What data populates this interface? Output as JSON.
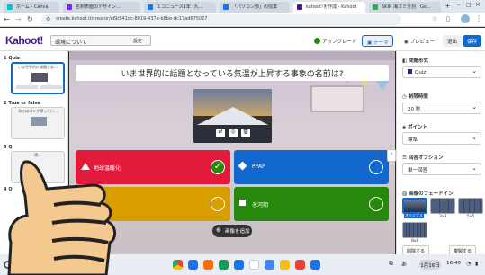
{
  "browser": {
    "tabs": [
      {
        "label": "ホーム - Canva",
        "color": "#00c4cc"
      },
      {
        "label": "名刺表面のデザイン…",
        "color": "#7d2ae8"
      },
      {
        "label": "エコニュース1年 (九…",
        "color": "#1a73e8"
      },
      {
        "label": "「パソコン部」の授業",
        "color": "#1a73e8"
      },
      {
        "label": "kahoot!を作成 - Kahoot",
        "color": "#46178f"
      },
      {
        "label": "SKIR 海ゴミ分別 - Go…",
        "color": "#34a853"
      }
    ],
    "url": "create.kahoot.it/creator/e6b541dc-8019-437e-b8be-dc17ad675027"
  },
  "header": {
    "logo": "Kahoot!",
    "title_value": "環境について",
    "settings_label": "設定",
    "upgrade_label": "アップグレード",
    "theme_label": "テーマ",
    "preview_label": "プレビュー",
    "exit_label": "退出",
    "save_label": "保存"
  },
  "questions": [
    {
      "number": "1",
      "type": "Quiz",
      "text": "いま世界的に話題とな…"
    },
    {
      "number": "2",
      "type": "True or false",
      "text": "海にはゴミが漂ってい…"
    },
    {
      "number": "3",
      "type": "Q",
      "text": "環…"
    },
    {
      "number": "4",
      "type": "Q",
      "text": ""
    }
  ],
  "editor": {
    "question": "いま世界的に話題となっている気温が上昇する事象の名前は?",
    "answers": [
      {
        "text": "地球温暖化",
        "color": "#e21b3c",
        "shape": "triangle",
        "correct": true
      },
      {
        "text": "PPAP",
        "color": "#1368ce",
        "shape": "diamond",
        "correct": false
      },
      {
        "text": "",
        "color": "#d89e00",
        "shape": "circle",
        "correct": false
      },
      {
        "text": "氷河期",
        "color": "#26890c",
        "shape": "square",
        "correct": false
      }
    ],
    "add_media_label": "画像を追加"
  },
  "sidebar": {
    "type_label": "問題形式",
    "type_value": "Quiz",
    "time_label": "制限時間",
    "time_value": "20 秒",
    "points_label": "ポイント",
    "points_value": "標準",
    "answer_options_label": "回答オプション",
    "answer_options_value": "単一回答",
    "bg_label": "画像のフェードイン",
    "bg_thumbs": [
      "オリジナル",
      "3x3",
      "5x5",
      "8x8"
    ],
    "delete_label": "削除する",
    "duplicate_label": "複製する"
  },
  "taskbar": {
    "ime": "あ",
    "date": "1月16日",
    "time": "16:40"
  }
}
